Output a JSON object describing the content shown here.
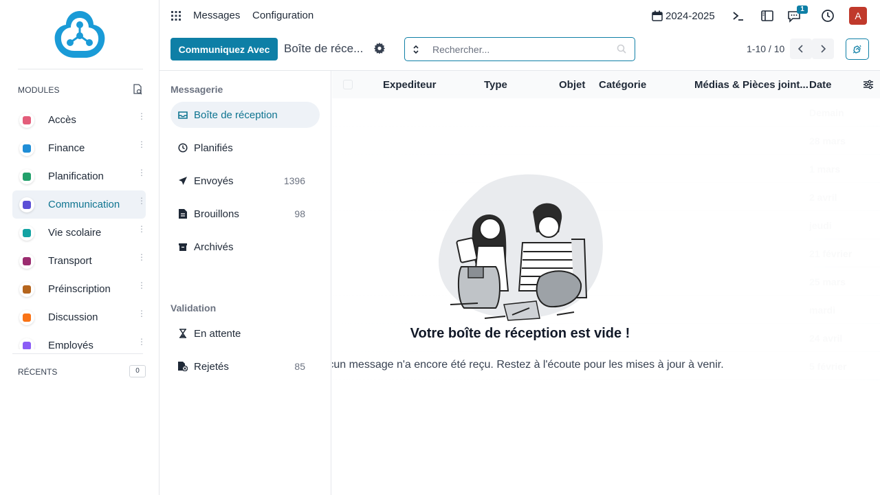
{
  "sidebar": {
    "modules_label": "MODULES",
    "recents_label": "RÉCENTS",
    "recents_count": "0",
    "items": [
      {
        "label": "Accès",
        "color": "#e35d7a"
      },
      {
        "label": "Finance",
        "color": "#1f8dd6"
      },
      {
        "label": "Planification",
        "color": "#22a06b"
      },
      {
        "label": "Communication",
        "color": "#5b4fd6",
        "active": true
      },
      {
        "label": "Vie scolaire",
        "color": "#13a3a3"
      },
      {
        "label": "Transport",
        "color": "#9b2c6f"
      },
      {
        "label": "Préinscription",
        "color": "#b5651d"
      },
      {
        "label": "Discussion",
        "color": "#f97316"
      },
      {
        "label": "Employés",
        "color": "#8b5cf6"
      }
    ]
  },
  "topbar": {
    "nav": [
      "Messages",
      "Configuration"
    ],
    "year": "2024-2025",
    "chat_badge": "1",
    "avatar": "A"
  },
  "controls": {
    "primary_button": "Communiquez Avec",
    "breadcrumb": "Boîte de réce...",
    "search_placeholder": "Rechercher...",
    "pager": "1-10 / 10"
  },
  "folders": {
    "messaging_title": "Messagerie",
    "validation_title": "Validation",
    "messaging": [
      {
        "label": "Boîte de réception",
        "count": "",
        "icon": "inbox-icon",
        "active": true
      },
      {
        "label": "Planifiés",
        "count": "",
        "icon": "clock-icon"
      },
      {
        "label": "Envoyés",
        "count": "1396",
        "icon": "send-icon"
      },
      {
        "label": "Brouillons",
        "count": "98",
        "icon": "draft-icon"
      },
      {
        "label": "Archivés",
        "count": "",
        "icon": "archive-icon"
      }
    ],
    "validation": [
      {
        "label": "En attente",
        "count": "",
        "icon": "hourglass-icon"
      },
      {
        "label": "Rejetés",
        "count": "85",
        "icon": "rejected-file-icon"
      }
    ]
  },
  "table": {
    "columns": [
      "Expediteur",
      "Type",
      "Objet",
      "Catégorie",
      "Médias & Pièces joint...",
      "Date"
    ],
    "ghost_dates": [
      "Demain",
      "28 mars",
      "1 mars",
      "2 avril",
      "jeudi",
      "21 février",
      "25 mars",
      "mardi",
      "24 avril",
      "5 février"
    ]
  },
  "empty_state": {
    "title": "Votre boîte de réception est vide !",
    "text": "cun message n'a encore été reçu. Restez à l'écoute pour les mises à jour à venir."
  },
  "colors": {
    "accent": "#0e7fa6",
    "avatar": "#c0392b"
  }
}
